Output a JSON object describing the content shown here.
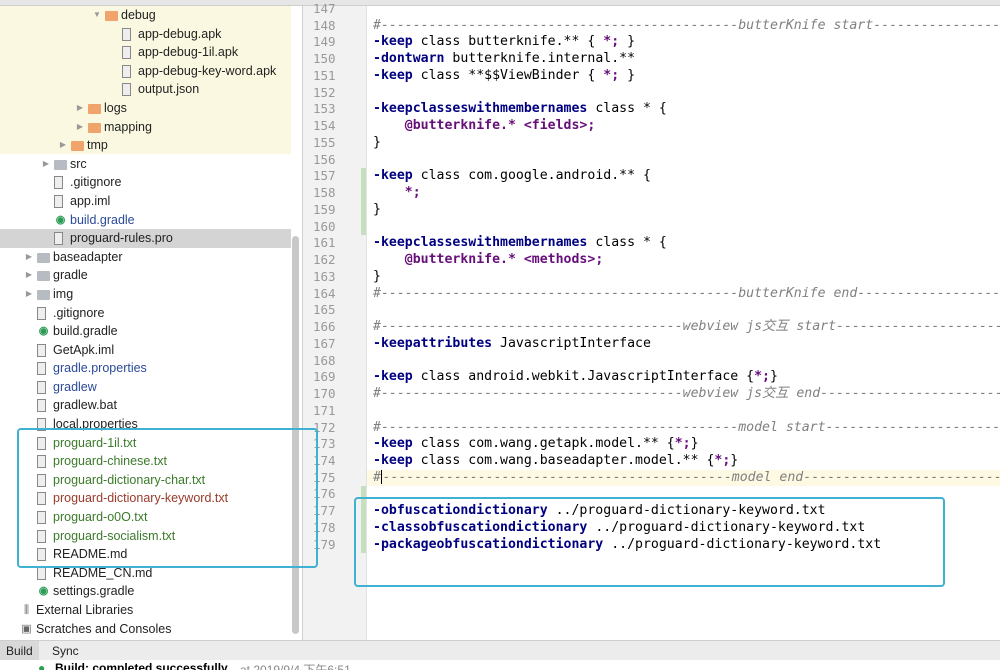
{
  "colors": {
    "accent_box": "#3fb1d3",
    "keyword": "#000080",
    "purple": "#660e7a",
    "comment": "#808080",
    "tree_blue": "#2b4a9a",
    "tree_green": "#3b7a2a",
    "tree_red": "#9a3a2a"
  },
  "tree": [
    {
      "label": "debug",
      "level": 5,
      "icon": "folder-icon",
      "arrow": "open"
    },
    {
      "label": "app-debug.apk",
      "level": 6,
      "icon": "apk-file-icon"
    },
    {
      "label": "app-debug-1il.apk",
      "level": 6,
      "icon": "apk-file-icon"
    },
    {
      "label": "app-debug-key-word.apk",
      "level": 6,
      "icon": "apk-file-icon"
    },
    {
      "label": "output.json",
      "level": 6,
      "icon": "json-file-icon"
    },
    {
      "label": "logs",
      "level": 4,
      "icon": "folder-icon",
      "arrow": "closed"
    },
    {
      "label": "mapping",
      "level": 4,
      "icon": "folder-icon",
      "arrow": "closed"
    },
    {
      "label": "tmp",
      "level": 3,
      "icon": "folder-icon",
      "arrow": "closed"
    },
    {
      "label": "src",
      "level": 2,
      "icon": "gray-folder-icon",
      "arrow": "closed"
    },
    {
      "label": ".gitignore",
      "level": 2,
      "icon": "file-icon"
    },
    {
      "label": "app.iml",
      "level": 2,
      "icon": "module-file-icon"
    },
    {
      "label": "build.gradle",
      "level": 2,
      "icon": "gradle-icon",
      "color": "blue"
    },
    {
      "label": "proguard-rules.pro",
      "level": 2,
      "icon": "file-icon",
      "selected": true
    },
    {
      "label": "baseadapter",
      "level": 1,
      "icon": "module-folder-icon",
      "arrow": "closed"
    },
    {
      "label": "gradle",
      "level": 1,
      "icon": "gray-folder-icon",
      "arrow": "closed"
    },
    {
      "label": "img",
      "level": 1,
      "icon": "gray-folder-icon",
      "arrow": "closed"
    },
    {
      "label": ".gitignore",
      "level": 1,
      "icon": "file-icon"
    },
    {
      "label": "build.gradle",
      "level": 1,
      "icon": "gradle-icon"
    },
    {
      "label": "GetApk.iml",
      "level": 1,
      "icon": "module-file-icon"
    },
    {
      "label": "gradle.properties",
      "level": 1,
      "icon": "properties-file-icon",
      "color": "blue"
    },
    {
      "label": "gradlew",
      "level": 1,
      "icon": "file-icon",
      "color": "blue"
    },
    {
      "label": "gradlew.bat",
      "level": 1,
      "icon": "file-icon"
    },
    {
      "label": "local.properties",
      "level": 1,
      "icon": "properties-file-icon"
    },
    {
      "label": "proguard-1il.txt",
      "level": 1,
      "icon": "file-icon",
      "color": "green"
    },
    {
      "label": "proguard-chinese.txt",
      "level": 1,
      "icon": "file-icon",
      "color": "green"
    },
    {
      "label": "proguard-dictionary-char.txt",
      "level": 1,
      "icon": "file-icon",
      "color": "green"
    },
    {
      "label": "proguard-dictionary-keyword.txt",
      "level": 1,
      "icon": "file-icon",
      "color": "red"
    },
    {
      "label": "proguard-o0O.txt",
      "level": 1,
      "icon": "file-icon",
      "color": "green"
    },
    {
      "label": "proguard-socialism.txt",
      "level": 1,
      "icon": "file-icon",
      "color": "green"
    },
    {
      "label": "README.md",
      "level": 1,
      "icon": "file-icon"
    },
    {
      "label": "README_CN.md",
      "level": 1,
      "icon": "file-icon"
    },
    {
      "label": "settings.gradle",
      "level": 1,
      "icon": "gradle-icon"
    },
    {
      "label": "External Libraries",
      "level": 0,
      "icon": "libraries-icon"
    },
    {
      "label": "Scratches and Consoles",
      "level": 0,
      "icon": "scratches-icon"
    }
  ],
  "editor": {
    "current_line": 175,
    "changed_lines": [
      157,
      158,
      159,
      160,
      176,
      177,
      178,
      179
    ],
    "lines": [
      {
        "n": "147",
        "tokens": []
      },
      {
        "n": "148",
        "tokens": [
          [
            "c",
            "#---------------------------------------------butterKnife start---------------------"
          ]
        ]
      },
      {
        "n": "149",
        "tokens": [
          [
            "k",
            "-keep"
          ],
          [
            "t",
            " class butterknife.** { "
          ],
          [
            "p",
            "*;"
          ],
          [
            "t",
            " }"
          ]
        ]
      },
      {
        "n": "150",
        "tokens": [
          [
            "k",
            "-dontwarn"
          ],
          [
            "t",
            " butterknife.internal.**"
          ]
        ]
      },
      {
        "n": "151",
        "tokens": [
          [
            "k",
            "-keep"
          ],
          [
            "t",
            " class **$$ViewBinder { "
          ],
          [
            "p",
            "*;"
          ],
          [
            "t",
            " }"
          ]
        ]
      },
      {
        "n": "152",
        "tokens": []
      },
      {
        "n": "153",
        "tokens": [
          [
            "k",
            "-keepclasseswithmembernames"
          ],
          [
            "t",
            " class * {"
          ]
        ]
      },
      {
        "n": "154",
        "tokens": [
          [
            "t",
            "    "
          ],
          [
            "p",
            "@butterknife.* <fields>;"
          ]
        ]
      },
      {
        "n": "155",
        "tokens": [
          [
            "t",
            "}"
          ]
        ]
      },
      {
        "n": "156",
        "tokens": []
      },
      {
        "n": "157",
        "tokens": [
          [
            "k",
            "-keep"
          ],
          [
            "t",
            " class com.google.android.** {"
          ]
        ]
      },
      {
        "n": "158",
        "tokens": [
          [
            "t",
            "    "
          ],
          [
            "p",
            "*;"
          ]
        ]
      },
      {
        "n": "159",
        "tokens": [
          [
            "t",
            "}"
          ]
        ]
      },
      {
        "n": "160",
        "tokens": []
      },
      {
        "n": "161",
        "tokens": [
          [
            "k",
            "-keepclasseswithmembernames"
          ],
          [
            "t",
            " class * {"
          ]
        ]
      },
      {
        "n": "162",
        "tokens": [
          [
            "t",
            "    "
          ],
          [
            "p",
            "@butterknife.* <methods>;"
          ]
        ]
      },
      {
        "n": "163",
        "tokens": [
          [
            "t",
            "}"
          ]
        ]
      },
      {
        "n": "164",
        "tokens": [
          [
            "c",
            "#---------------------------------------------butterKnife end-----------------------"
          ]
        ]
      },
      {
        "n": "165",
        "tokens": []
      },
      {
        "n": "166",
        "tokens": [
          [
            "c",
            "#--------------------------------------webview js交互 start---------------------------"
          ]
        ]
      },
      {
        "n": "167",
        "tokens": [
          [
            "k",
            "-keepattributes"
          ],
          [
            "t",
            " JavascriptInterface"
          ]
        ]
      },
      {
        "n": "168",
        "tokens": []
      },
      {
        "n": "169",
        "tokens": [
          [
            "k",
            "-keep"
          ],
          [
            "t",
            " class android.webkit.JavascriptInterface {"
          ],
          [
            "p",
            "*;"
          ],
          [
            "t",
            "}"
          ]
        ]
      },
      {
        "n": "170",
        "tokens": [
          [
            "c",
            "#--------------------------------------webview js交互 end-----------------------------"
          ]
        ]
      },
      {
        "n": "171",
        "tokens": []
      },
      {
        "n": "172",
        "tokens": [
          [
            "c",
            "#---------------------------------------------model start--------------------------"
          ]
        ]
      },
      {
        "n": "173",
        "tokens": [
          [
            "k",
            "-keep"
          ],
          [
            "t",
            " class com.wang.getapk.model.** {"
          ],
          [
            "p",
            "*;"
          ],
          [
            "t",
            "}"
          ]
        ]
      },
      {
        "n": "174",
        "tokens": [
          [
            "k",
            "-keep"
          ],
          [
            "t",
            " class com.wang.baseadapter.model.** {"
          ],
          [
            "p",
            "*;"
          ],
          [
            "t",
            "}"
          ]
        ]
      },
      {
        "n": "175",
        "tokens": [
          [
            "c",
            "#"
          ],
          [
            "caret",
            ""
          ],
          [
            "c",
            "--------------------------------------------model end----------------------------"
          ]
        ]
      },
      {
        "n": "176",
        "tokens": []
      },
      {
        "n": "177",
        "tokens": [
          [
            "k",
            "-obfuscationdictionary"
          ],
          [
            "t",
            " ../proguard-dictionary-keyword.txt"
          ]
        ]
      },
      {
        "n": "178",
        "tokens": [
          [
            "k",
            "-classobfuscationdictionary"
          ],
          [
            "t",
            " ../proguard-dictionary-keyword.txt"
          ]
        ]
      },
      {
        "n": "179",
        "tokens": [
          [
            "k",
            "-packageobfuscationdictionary"
          ],
          [
            "t",
            " ../proguard-dictionary-keyword.txt"
          ]
        ]
      }
    ]
  },
  "bottom": {
    "tabs": [
      {
        "label": "Build",
        "active": true
      },
      {
        "label": "Sync"
      }
    ],
    "status_text": "Build: completed successfully",
    "status_time": "at 2019/9/4 下午6:51"
  }
}
